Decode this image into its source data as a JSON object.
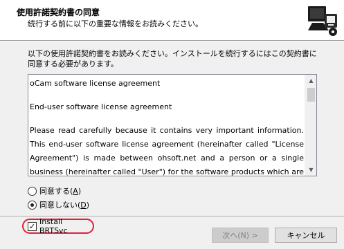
{
  "header": {
    "title": "使用許諾契約書の同意",
    "subtitle": "続行する前に以下の重要な情報をお読みください。"
  },
  "intro_text": "以下の使用許諾契約書をお読みください。インストールを続行するにはこの契約書に同意する必要があります。",
  "license": {
    "line1": "oCam software license agreement",
    "line2": "End-user software license agreement",
    "paragraph": "Please read carefully because it contains very important information. This end-user software license agreement (hereinafter called \"License Agreement\") is made between ohsoft.net and a person or a single business (hereinafter called \"User\") for the software products which are developed"
  },
  "options": {
    "agree_label": "同意する(",
    "agree_key": "A",
    "disagree_label": "同意しない(",
    "disagree_key": "D",
    "close_paren": ")",
    "selected": "disagree"
  },
  "checkbox": {
    "label": "Install BRTSvc",
    "checked": true,
    "check_glyph": "✓"
  },
  "buttons": {
    "next_label": "次へ(N) >",
    "cancel_label": "キャンセル"
  },
  "colors": {
    "highlight_ring": "#e0203a",
    "header_bg": "#ffffff",
    "window_bg": "#f0f0f0"
  }
}
